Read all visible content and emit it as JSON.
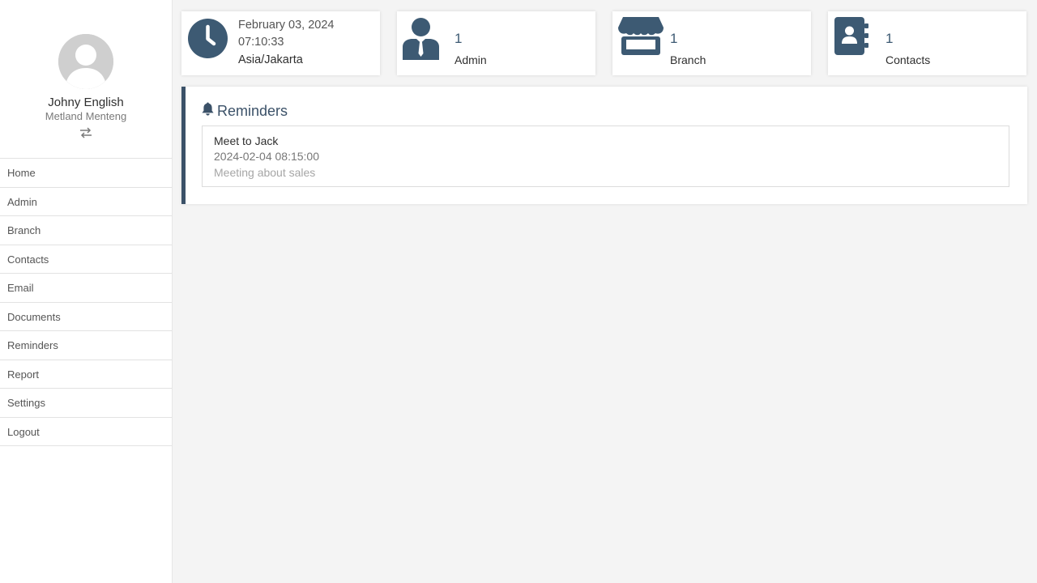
{
  "colors": {
    "accent": "#3b5168",
    "icon": "#3d5a73"
  },
  "profile": {
    "avatar_icon": "user-avatar-icon",
    "name": "Johny English",
    "branch": "Metland Menteng",
    "switch_icon": "switch-arrows-icon"
  },
  "nav": {
    "items": [
      {
        "label": "Home"
      },
      {
        "label": "Admin"
      },
      {
        "label": "Branch"
      },
      {
        "label": "Contacts"
      },
      {
        "label": "Email"
      },
      {
        "label": "Documents"
      },
      {
        "label": "Reminders"
      },
      {
        "label": "Report"
      },
      {
        "label": "Settings"
      },
      {
        "label": "Logout"
      }
    ]
  },
  "clock": {
    "icon": "clock-icon",
    "date": "February 03, 2024",
    "time": "07:10:33",
    "timezone": "Asia/Jakarta"
  },
  "stats": {
    "admin": {
      "icon": "admin-user-icon",
      "count": "1",
      "label": "Admin"
    },
    "branch": {
      "icon": "store-icon",
      "count": "1",
      "label": "Branch"
    },
    "contacts": {
      "icon": "address-book-icon",
      "count": "1",
      "label": "Contacts"
    }
  },
  "reminders": {
    "icon": "bell-icon",
    "title": "Reminders",
    "items": [
      {
        "title": "Meet to Jack",
        "datetime": "2024-02-04 08:15:00",
        "description": "Meeting about sales"
      }
    ]
  }
}
